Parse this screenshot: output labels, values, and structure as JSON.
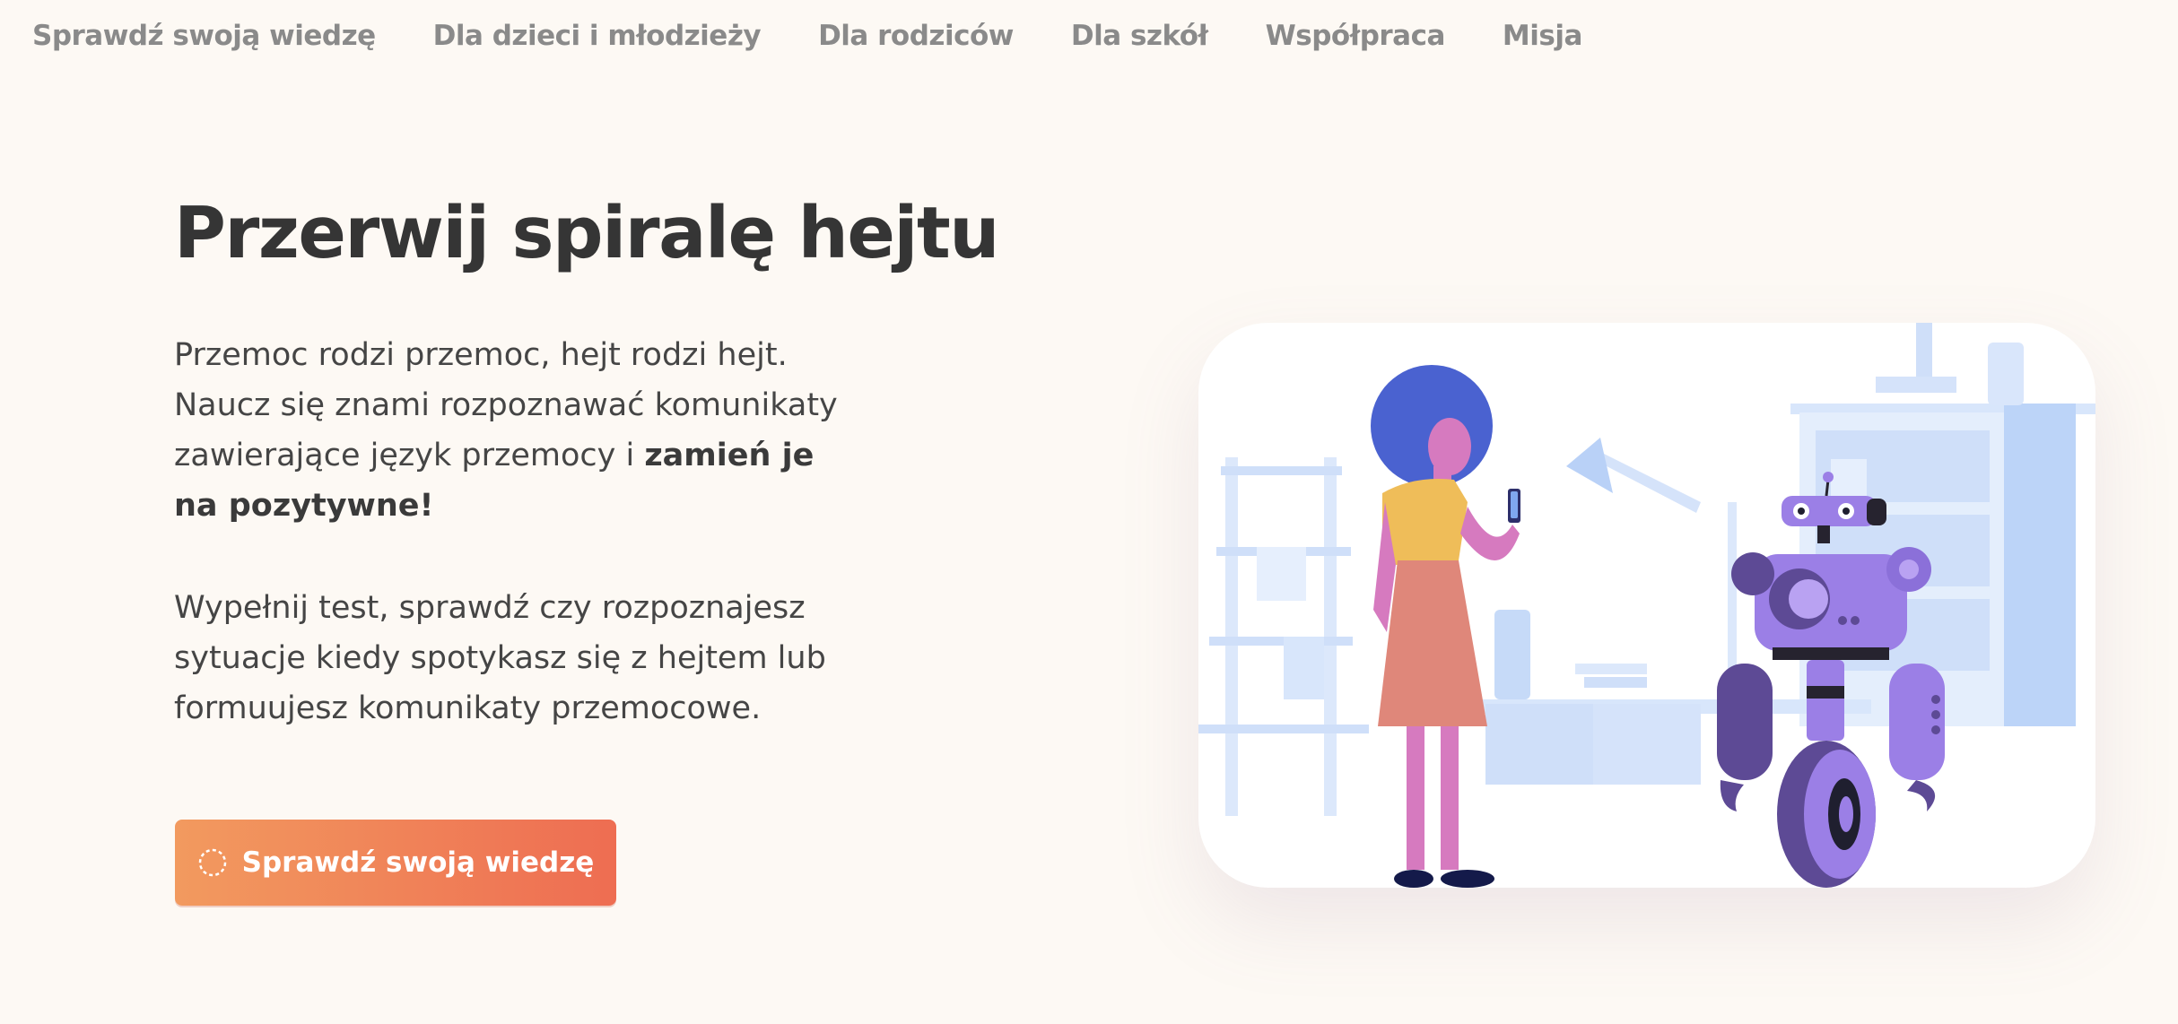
{
  "nav": {
    "items": [
      {
        "label": "Sprawdź swoją wiedzę"
      },
      {
        "label": "Dla dzieci i młodzieży"
      },
      {
        "label": "Dla rodziców"
      },
      {
        "label": "Dla szkół"
      },
      {
        "label": "Współpraca"
      },
      {
        "label": "Misja"
      }
    ]
  },
  "hero": {
    "title": "Przerwij spiralę hejtu",
    "paragraph1_text": "Przemoc rodzi przemoc, hejt rodzi hejt. Naucz się znami rozpoznawać komunikaty zawierające język przemocy i ",
    "paragraph1_bold": "zamień je na pozytywne!",
    "paragraph2": "Wypełnij test, sprawdź czy rozpoznajesz sytuacje kiedy spotykasz się z hejtem lub formuujesz komunikaty przemocowe.",
    "cta_label": "Sprawdź swoją wiedzę",
    "cta_icon": "dashed-circle-icon"
  },
  "illustration": {
    "icons": [
      "woman-with-phone-illustration",
      "robot-illustration",
      "bookshelf-illustration",
      "desk-lamp-illustration"
    ]
  },
  "colors": {
    "background": "#fdf9f4",
    "nav_text": "#8a8a8a",
    "title": "#353535",
    "cta_gradient_start": "#f29a5f",
    "cta_gradient_end": "#ee6d52",
    "robot": "#9b7fe6",
    "woman_hair": "#4a62d0"
  }
}
